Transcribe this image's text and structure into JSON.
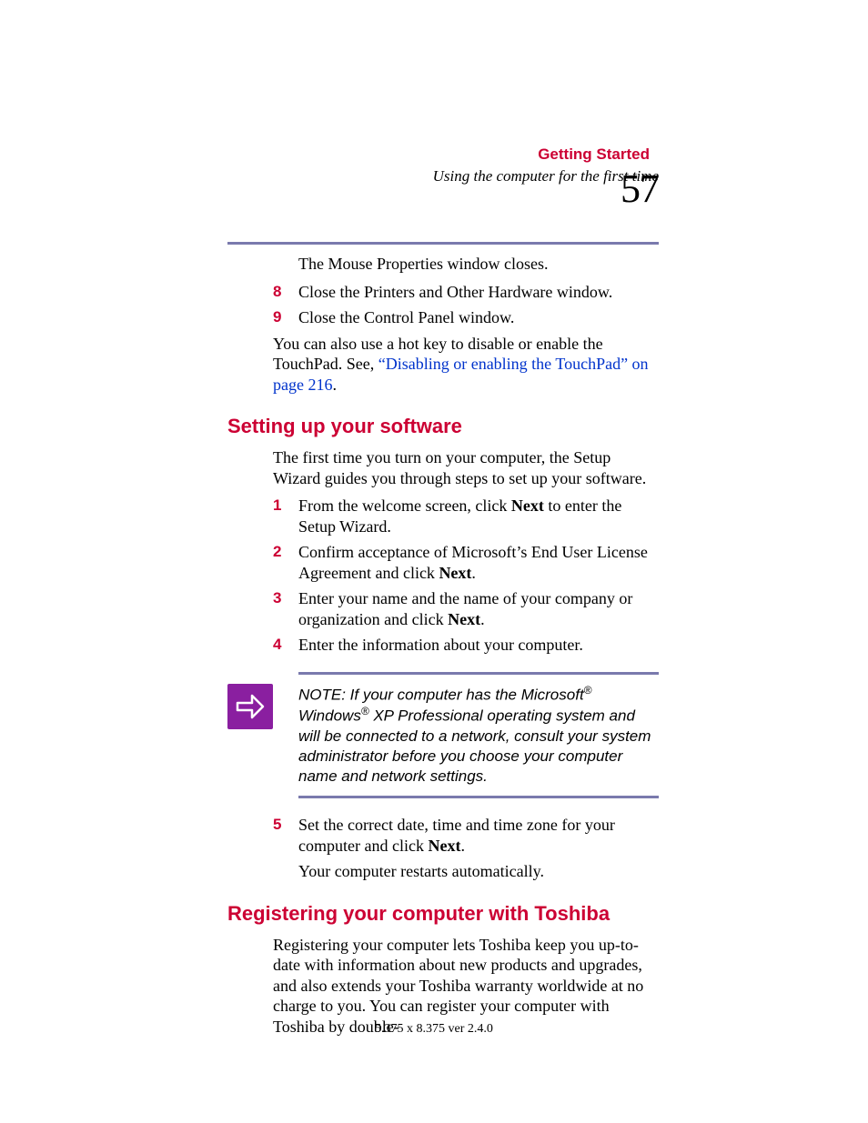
{
  "header": {
    "chapter": "Getting Started",
    "subtitle": "Using the computer for the first time",
    "page_number": "57"
  },
  "intro_line": "The Mouse Properties window closes.",
  "continued_list": [
    {
      "num": "8",
      "text": "Close the Printers and Other Hardware window."
    },
    {
      "num": "9",
      "text": "Close the Control Panel window."
    }
  ],
  "hotkey_para_pre": "You can also use a hot key to disable or enable the TouchPad. See, ",
  "hotkey_link": "“Disabling or enabling the TouchPad” on page 216",
  "hotkey_para_post": ".",
  "section1": {
    "heading": "Setting up your software",
    "intro": "The first time you turn on your computer, the Setup Wizard guides you through steps to set up your software.",
    "steps_a": [
      {
        "num": "1",
        "pre": "From the welcome screen, click ",
        "bold": "Next",
        "post": " to enter the Setup Wizard."
      },
      {
        "num": "2",
        "pre": "Confirm acceptance of Microsoft’s End User License Agreement and click ",
        "bold": "Next",
        "post": "."
      },
      {
        "num": "3",
        "pre": "Enter your name and the name of your company or organization and click ",
        "bold": "Next",
        "post": "."
      },
      {
        "num": "4",
        "pre": "Enter the information about your computer.",
        "bold": "",
        "post": ""
      }
    ],
    "note_prefix": "NOTE: If your computer has the Microsoft",
    "note_mid1": " Windows",
    "note_mid2": " XP Professional operating system and will be connected to a network, consult your system administrator before you choose your computer name and network settings.",
    "steps_b": [
      {
        "num": "5",
        "pre": "Set the correct date, time and time zone for your computer and click ",
        "bold": "Next",
        "post": "."
      }
    ],
    "after_steps": "Your computer restarts automatically."
  },
  "section2": {
    "heading": "Registering your computer with Toshiba",
    "body": "Registering your computer lets Toshiba keep you up-to-date with information about new products and upgrades, and also extends your Toshiba warranty worldwide at no charge to you. You can register your computer with Toshiba by double-"
  },
  "footer": "5.375 x 8.375 ver 2.4.0",
  "colors": {
    "accent": "#cc0033",
    "rule": "#7a7aad",
    "link": "#0033cc",
    "note_bg": "#8a1fa0"
  }
}
